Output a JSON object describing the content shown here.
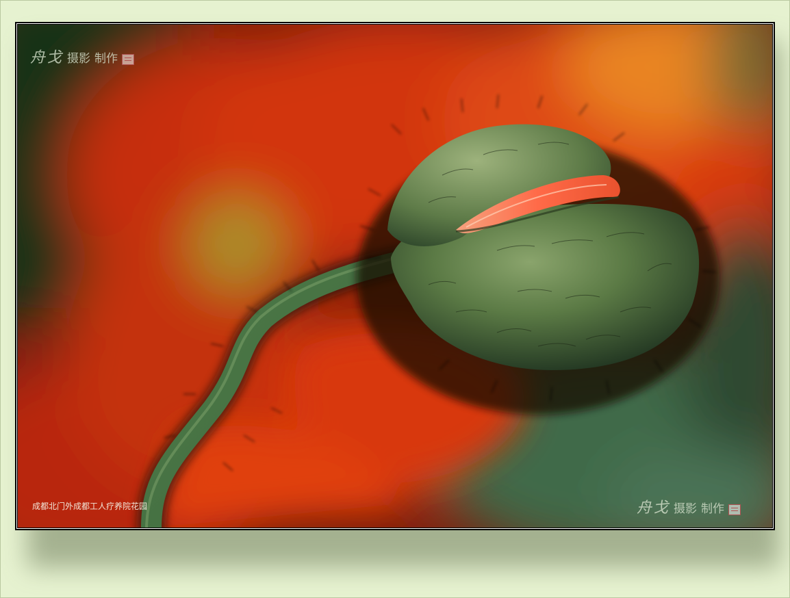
{
  "watermark_top": {
    "signature": "舟戈",
    "text_photo": "摄影",
    "text_made": "制作"
  },
  "watermark_bottom": {
    "signature": "舟戈",
    "text_photo": "摄影",
    "text_made": "制作"
  },
  "caption": "成都北门外成都工人疗养院花园",
  "colors": {
    "background": "#e6f2d0",
    "frame": "#000000",
    "poppy_red": "#d8380e",
    "bud_green": "#4c6a3c",
    "petal_peek": "#f37a5a"
  }
}
